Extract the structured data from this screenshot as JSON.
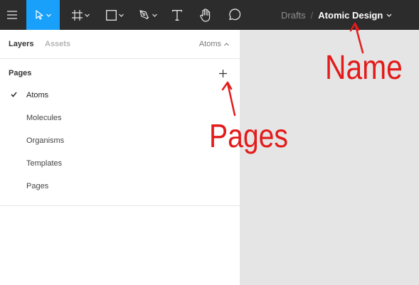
{
  "toolbar": {
    "tools": [
      "menu-icon",
      "move-icon",
      "frame-icon",
      "shape-icon",
      "pen-icon",
      "text-icon",
      "hand-icon",
      "comment-icon"
    ],
    "accent_color": "#18a0fb",
    "background_color": "#2c2c2c"
  },
  "breadcrumb": {
    "folder": "Drafts",
    "separator": "/",
    "file_name": "Atomic Design"
  },
  "panel": {
    "tabs": {
      "layers": "Layers",
      "assets": "Assets"
    },
    "current_page": "Atoms",
    "pages_header": "Pages",
    "pages": [
      {
        "label": "Atoms",
        "active": true
      },
      {
        "label": "Molecules",
        "active": false
      },
      {
        "label": "Organisms",
        "active": false
      },
      {
        "label": "Templates",
        "active": false
      },
      {
        "label": "Pages",
        "active": false
      }
    ]
  },
  "annotations": {
    "name_label": "Name",
    "pages_label": "Pages",
    "color": "#e31b1b"
  }
}
